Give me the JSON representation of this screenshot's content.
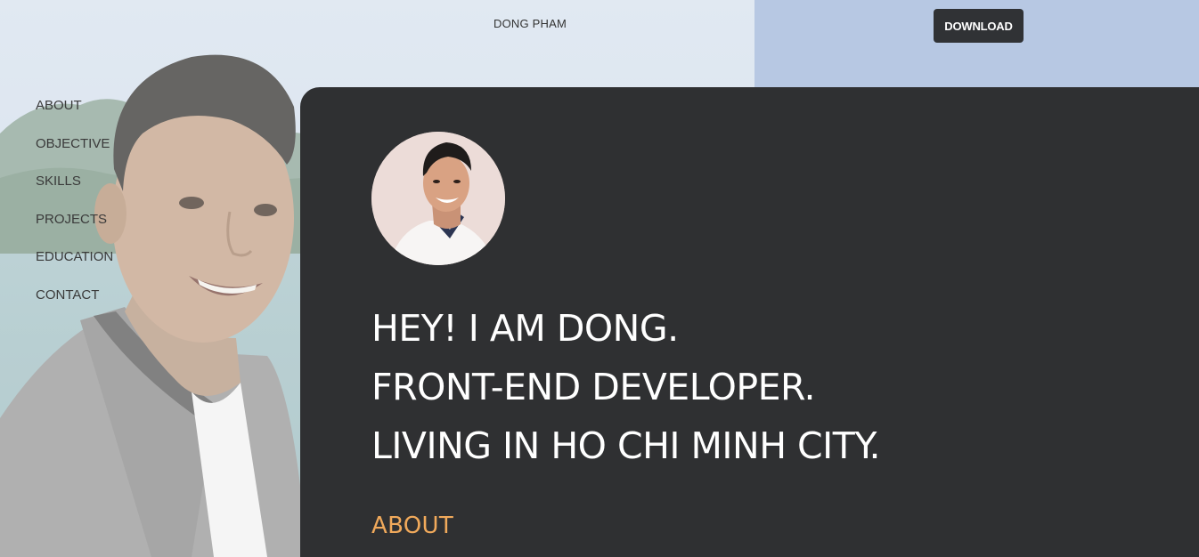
{
  "header": {
    "brand": "DONG PHAM",
    "download_label": "DOWNLOAD"
  },
  "nav": {
    "items": [
      {
        "label": "ABOUT"
      },
      {
        "label": "OBJECTIVE"
      },
      {
        "label": "SKILLS"
      },
      {
        "label": "PROJECTS"
      },
      {
        "label": "EDUCATION"
      },
      {
        "label": "CONTACT"
      }
    ]
  },
  "hero": {
    "lines": [
      "HEY! I AM DONG.",
      "FRONT-END DEVELOPER.",
      "LIVING IN HO CHI MINH CITY."
    ],
    "section_title": "ABOUT"
  },
  "colors": {
    "panel": "#2f3032",
    "accent": "#f0a95b",
    "button": "#303235",
    "sky": "#b7c8e3"
  }
}
